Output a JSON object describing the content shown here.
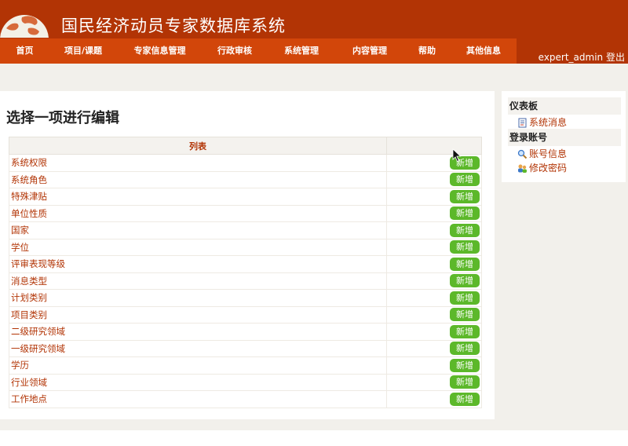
{
  "header": {
    "title": "国民经济动员专家数据库系统",
    "user": "expert_admin",
    "logout": "登出"
  },
  "nav": [
    "首页",
    "项目/课题",
    "专家信息管理",
    "行政审核",
    "系统管理",
    "内容管理",
    "帮助",
    "其他信息"
  ],
  "main": {
    "heading": "选择一项进行编辑",
    "table_header": "列表",
    "add_label": "新增",
    "rows": [
      "系统权限",
      "系统角色",
      "特殊津贴",
      "单位性质",
      "国家",
      "学位",
      "评审表现等级",
      "消息类型",
      "计划类别",
      "项目类别",
      "二级研究领域",
      "一级研究领域",
      "学历",
      "行业领域",
      "工作地点"
    ]
  },
  "sidebar": {
    "dashboard_title": "仪表板",
    "system_messages": "系统消息",
    "account_title": "登录账号",
    "account_info": "账号信息",
    "change_password": "修改密码"
  },
  "colors": {
    "header_bg": "#b23405",
    "nav_bg": "#d2460a",
    "add_button": "#5cb82a",
    "link": "#b23405"
  },
  "icons": {
    "logo": "globe-logo-icon",
    "system_messages": "document-icon",
    "account_info": "magnifier-icon",
    "change_password": "users-key-icon"
  }
}
